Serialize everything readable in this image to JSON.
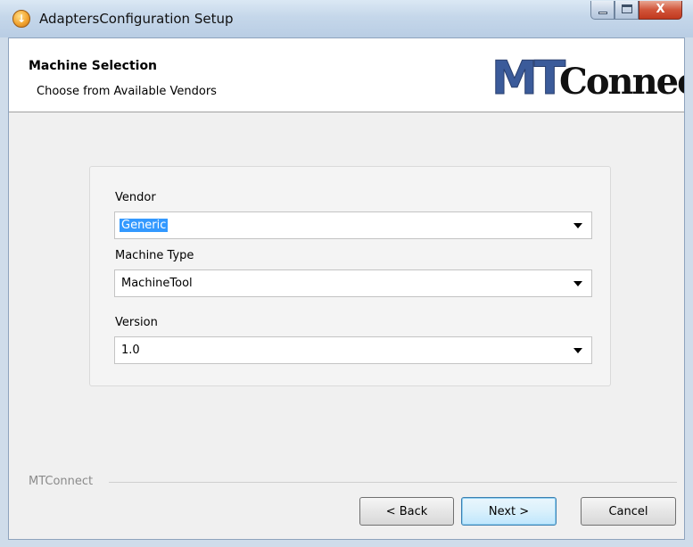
{
  "window": {
    "title": "AdaptersConfiguration Setup",
    "icon": "setup-installer-icon",
    "controls": {
      "minimize": "minimize-icon",
      "maximize": "maximize-icon",
      "close": "close-icon",
      "close_glyph": "X"
    }
  },
  "header": {
    "title": "Machine Selection",
    "subtitle": "Choose from Available Vendors",
    "logo": {
      "text_mt": "MT",
      "text_connect": "Connect"
    }
  },
  "form": {
    "vendor": {
      "label": "Vendor",
      "value": "Generic"
    },
    "machine_type": {
      "label": "Machine Type",
      "value": "MachineTool"
    },
    "version": {
      "label": "Version",
      "value": "1.0"
    }
  },
  "footer": {
    "brand": "MTConnect",
    "buttons": {
      "back": "< Back",
      "next": "Next >",
      "cancel": "Cancel"
    }
  },
  "colors": {
    "selection": "#3399ff",
    "logo_blue": "#3b5b9a",
    "logo_black": "#111111"
  }
}
